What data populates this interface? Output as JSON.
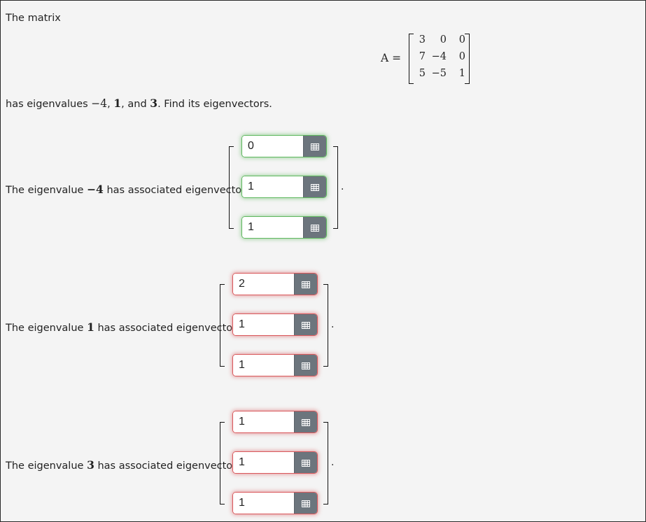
{
  "intro": "The matrix",
  "matrix": {
    "lhs": "A =",
    "rows": [
      [
        "3",
        "0",
        "0"
      ],
      [
        "7",
        "−4",
        "0"
      ],
      [
        "5",
        "−5",
        "1"
      ]
    ]
  },
  "eigenvalues_sentence": {
    "prefix": "has eigenvalues ",
    "ev1": "−4",
    "sep1": ", ",
    "ev2": "1",
    "sep2": ", and ",
    "ev3": "3",
    "suffix": ". Find its eigenvectors."
  },
  "blocks": [
    {
      "label_prefix": "The eigenvalue ",
      "eigenvalue": "−4",
      "label_suffix": " has associated eigenvector",
      "entries": [
        "0",
        "1",
        "1"
      ],
      "status": [
        "correct",
        "correct",
        "correct"
      ],
      "period": "."
    },
    {
      "label_prefix": "The eigenvalue ",
      "eigenvalue": "1",
      "label_suffix": " has associated eigenvector",
      "entries": [
        "2",
        "1",
        "1"
      ],
      "status": [
        "incorrect",
        "incorrect",
        "incorrect"
      ],
      "period": "."
    },
    {
      "label_prefix": "The eigenvalue ",
      "eigenvalue": "3",
      "label_suffix": " has associated eigenvector",
      "entries": [
        "1",
        "1",
        "1"
      ],
      "status": [
        "incorrect",
        "incorrect",
        "incorrect"
      ],
      "period": "."
    }
  ],
  "icons": {
    "matrix_button": "keypad-grid-icon"
  },
  "colors": {
    "correct": "#5fb85f",
    "incorrect": "#d9585b",
    "button": "#6c757d"
  }
}
